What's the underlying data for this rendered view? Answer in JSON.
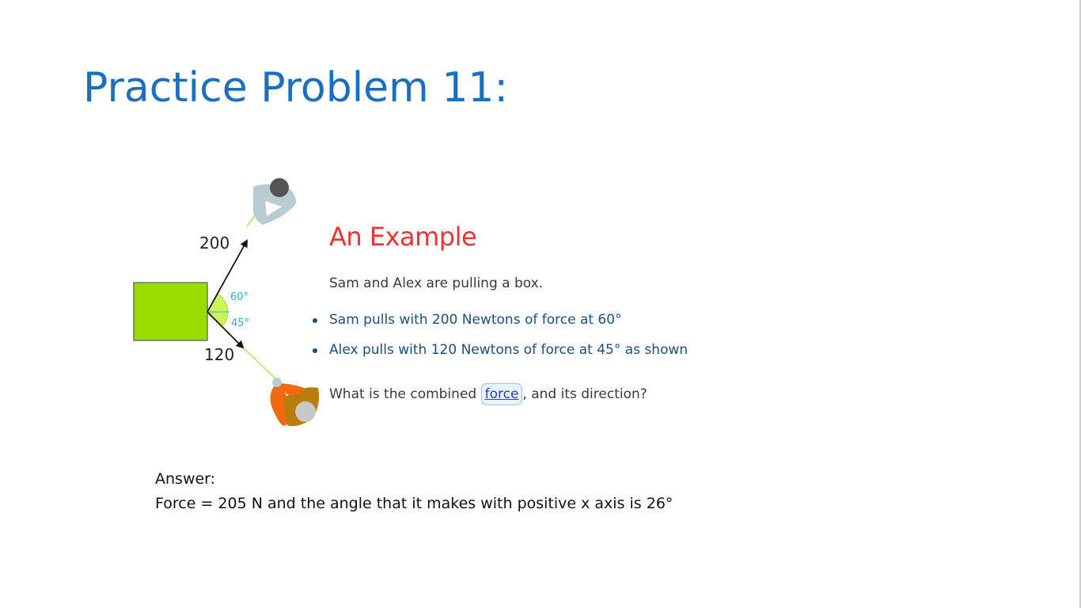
{
  "slide": {
    "title": "Practice Problem 11:"
  },
  "diagram": {
    "force_label_top": "200",
    "force_label_bottom": "120",
    "angle_top": "60°",
    "angle_bottom": "45°"
  },
  "example": {
    "title": "An Example",
    "intro": "Sam and Alex are pulling a box.",
    "bullets": [
      "Sam pulls with 200 Newtons of force at 60°",
      "Alex pulls with 120 Newtons of force at 45° as shown"
    ],
    "question_before": "What is the combined ",
    "question_link": "force",
    "question_after": ", and its direction?"
  },
  "answer": {
    "label": "Answer:",
    "text": "Force = 205 N and the angle that it makes with positive x axis is 26°"
  },
  "colors": {
    "title": "#1a6fbf",
    "example_title": "#ee3333",
    "bullet_text": "#1f4e79",
    "box_fill": "#99dd00",
    "angle_label": "#33aadd",
    "link": "#1f3fd6"
  }
}
